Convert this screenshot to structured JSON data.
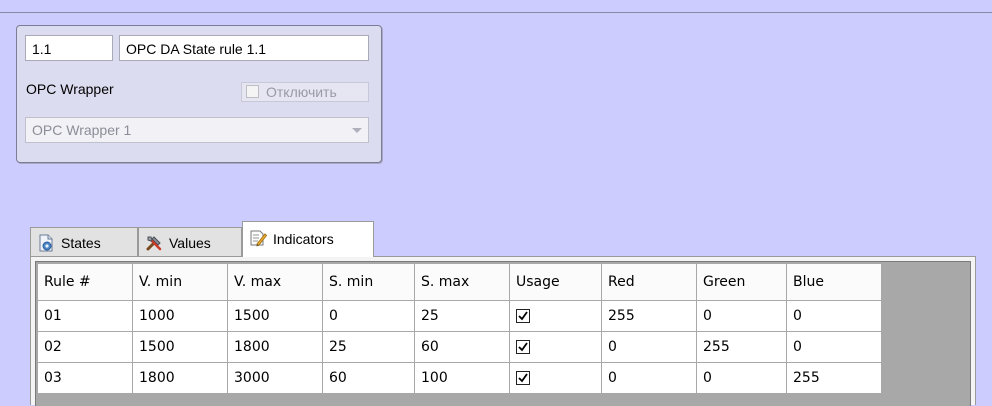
{
  "object_panel": {
    "id_value": "1.1",
    "name_value": "OPC DA State rule 1.1",
    "wrapper_label": "OPC Wrapper",
    "disable_label": "Отключить",
    "disable_checked": false,
    "wrapper_select_value": "OPC Wrapper 1"
  },
  "tabs": [
    {
      "label": "States",
      "icon": "states-icon",
      "active": false
    },
    {
      "label": "Values",
      "icon": "values-icon",
      "active": false
    },
    {
      "label": "Indicators",
      "icon": "indicators-icon",
      "active": true
    }
  ],
  "grid": {
    "columns": [
      "Rule #",
      "V. min",
      "V. max",
      "S. min",
      "S. max",
      "Usage",
      "Red",
      "Green",
      "Blue"
    ],
    "rows": [
      {
        "rule": "01",
        "vmin": "1000",
        "vmax": "1500",
        "smin": "0",
        "smax": "25",
        "usage": true,
        "red": "255",
        "green": "0",
        "blue": "0"
      },
      {
        "rule": "02",
        "vmin": "1500",
        "vmax": "1800",
        "smin": "25",
        "smax": "60",
        "usage": true,
        "red": "0",
        "green": "255",
        "blue": "0"
      },
      {
        "rule": "03",
        "vmin": "1800",
        "vmax": "3000",
        "smin": "60",
        "smax": "100",
        "usage": true,
        "red": "0",
        "green": "0",
        "blue": "255"
      }
    ]
  },
  "colors": {
    "background": "#ccccff",
    "panel": "#dcdcf0",
    "grid_empty": "#a8a8a8"
  }
}
